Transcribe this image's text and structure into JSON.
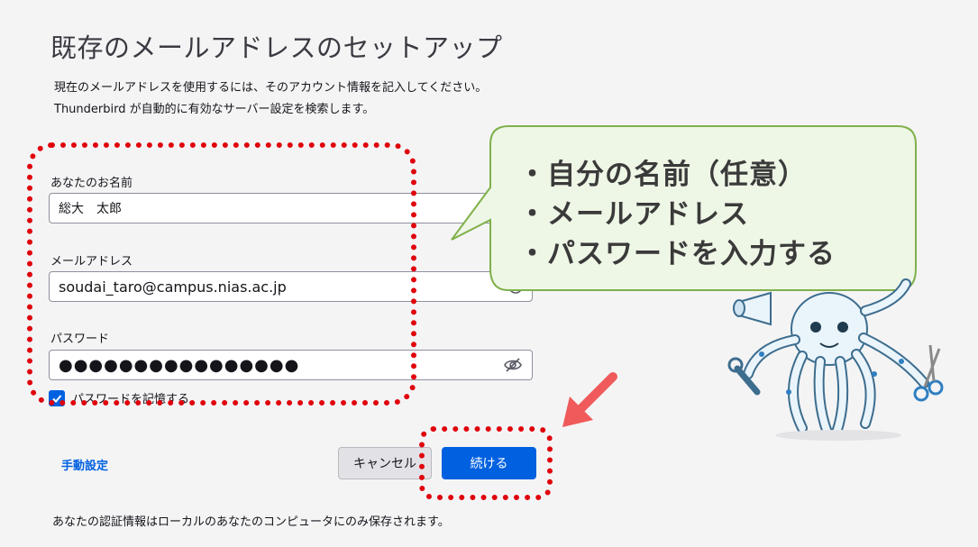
{
  "page": {
    "title": "既存のメールアドレスのセットアップ",
    "description_line1": "現在のメールアドレスを使用するには、そのアカウント情報を記入してください。",
    "description_line2": "Thunderbird が自動的に有効なサーバー設定を検索します。"
  },
  "form": {
    "name_label": "あなたのお名前",
    "name_value": "総大　太郎",
    "email_label": "メールアドレス",
    "email_value": "soudai_taro@campus.nias.ac.jp",
    "password_label": "パスワード",
    "password_value": "●●●●●●●●●●●●●●●●",
    "remember_label": "パスワードを記憶する",
    "remember_checked": true
  },
  "actions": {
    "manual_config": "手動設定",
    "cancel": "キャンセル",
    "continue": "続ける"
  },
  "footer_note": "あなたの認証情報はローカルのあなたのコンピュータにのみ保存されます。",
  "callout": {
    "line1": "・自分の名前（任意）",
    "line2": "・メールアドレス",
    "line3": "・パスワードを入力する"
  },
  "colors": {
    "accent": "#0061e0",
    "annotation_red": "#e0000b",
    "callout_fill": "#eef6e6",
    "callout_border": "#7fb04a",
    "arrow": "#f05a5a"
  },
  "icons": {
    "password_toggle": "eye-slash-icon",
    "checkbox": "checkmark-icon",
    "mascot": "thunderbird-octopus-mascot"
  }
}
